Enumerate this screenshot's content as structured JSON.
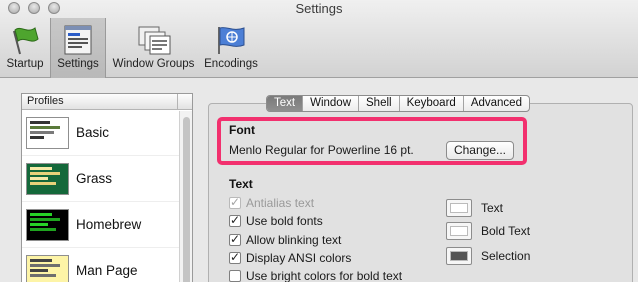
{
  "window": {
    "title": "Settings"
  },
  "toolbar": {
    "items": [
      {
        "label": "Startup",
        "icon": "flag-icon"
      },
      {
        "label": "Settings",
        "icon": "settings-window-icon",
        "selected": true
      },
      {
        "label": "Window Groups",
        "icon": "window-groups-icon"
      },
      {
        "label": "Encodings",
        "icon": "encodings-flag-icon"
      }
    ]
  },
  "profiles": {
    "header": "Profiles",
    "items": [
      {
        "name": "Basic",
        "theme_bg": "#ffffff"
      },
      {
        "name": "Grass",
        "theme_bg": "#14683a"
      },
      {
        "name": "Homebrew",
        "theme_bg": "#000000"
      },
      {
        "name": "Man Page",
        "theme_bg": "#fdf4a7"
      }
    ]
  },
  "tabs": [
    "Text",
    "Window",
    "Shell",
    "Keyboard",
    "Advanced"
  ],
  "active_tab": "Text",
  "font": {
    "title": "Font",
    "value": "Menlo Regular for Powerline 16 pt.",
    "change_label": "Change..."
  },
  "text_section": {
    "title": "Text",
    "options": [
      {
        "label": "Antialias text",
        "checked": true,
        "disabled": true
      },
      {
        "label": "Use bold fonts",
        "checked": true,
        "disabled": false
      },
      {
        "label": "Allow blinking text",
        "checked": true,
        "disabled": false
      },
      {
        "label": "Display ANSI colors",
        "checked": true,
        "disabled": false
      },
      {
        "label": "Use bright colors for bold text",
        "checked": false,
        "disabled": false
      }
    ],
    "colors": [
      {
        "label": "Text",
        "color": "#ffffff"
      },
      {
        "label": "Bold Text",
        "color": "#ffffff"
      },
      {
        "label": "Selection",
        "color": "#555555"
      }
    ]
  },
  "colors": {
    "highlight": "#f2306e",
    "active_tab": "#808080"
  }
}
